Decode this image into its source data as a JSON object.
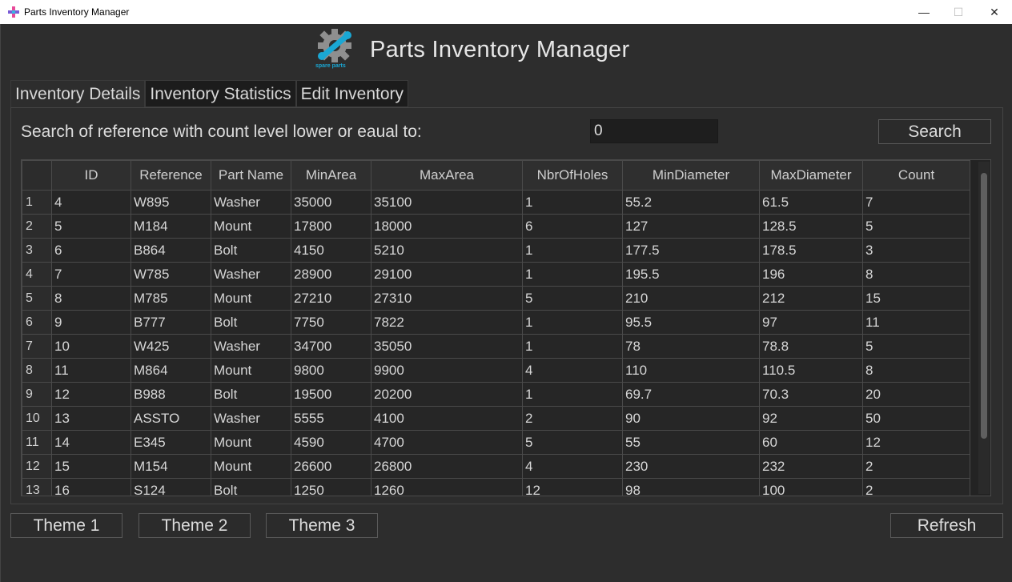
{
  "window": {
    "title": "Parts Inventory Manager",
    "minimize": "—",
    "maximize": "☐",
    "close": "✕"
  },
  "header": {
    "title": "Parts Inventory Manager",
    "logo_text": "spare parts",
    "logo_color": "#1aa7d4"
  },
  "tabs": [
    {
      "label": "Inventory Details",
      "active": true
    },
    {
      "label": "Inventory Statistics",
      "active": false
    },
    {
      "label": "Edit Inventory",
      "active": false
    }
  ],
  "search": {
    "label": "Search of reference with count level lower or eaual to:",
    "value": "0",
    "button": "Search"
  },
  "table": {
    "columns": [
      "ID",
      "Reference",
      "Part Name",
      "MinArea",
      "MaxArea",
      "NbrOfHoles",
      "MinDiameter",
      "MaxDiameter",
      "Count"
    ],
    "rows": [
      [
        "1",
        "4",
        "W895",
        "Washer",
        "35000",
        "35100",
        "1",
        "55.2",
        "61.5",
        "7"
      ],
      [
        "2",
        "5",
        "M184",
        "Mount",
        "17800",
        "18000",
        "6",
        "127",
        "128.5",
        "5"
      ],
      [
        "3",
        "6",
        "B864",
        "Bolt",
        "4150",
        "5210",
        "1",
        "177.5",
        "178.5",
        "3"
      ],
      [
        "4",
        "7",
        "W785",
        "Washer",
        "28900",
        "29100",
        "1",
        "195.5",
        "196",
        "8"
      ],
      [
        "5",
        "8",
        "M785",
        "Mount",
        "27210",
        "27310",
        "5",
        "210",
        "212",
        "15"
      ],
      [
        "6",
        "9",
        "B777",
        "Bolt",
        "7750",
        "7822",
        "1",
        "95.5",
        "97",
        "11"
      ],
      [
        "7",
        "10",
        "W425",
        "Washer",
        "34700",
        "35050",
        "1",
        "78",
        "78.8",
        "5"
      ],
      [
        "8",
        "11",
        "M864",
        "Mount",
        "9800",
        "9900",
        "4",
        "110",
        "110.5",
        "8"
      ],
      [
        "9",
        "12",
        "B988",
        "Bolt",
        "19500",
        "20200",
        "1",
        "69.7",
        "70.3",
        "20"
      ],
      [
        "10",
        "13",
        "ASSTO",
        "Washer",
        "5555",
        "4100",
        "2",
        "90",
        "92",
        "50"
      ],
      [
        "11",
        "14",
        "E345",
        "Mount",
        "4590",
        "4700",
        "5",
        "55",
        "60",
        "12"
      ],
      [
        "12",
        "15",
        "M154",
        "Mount",
        "26600",
        "26800",
        "4",
        "230",
        "232",
        "2"
      ],
      [
        "13",
        "16",
        "S124",
        "Bolt",
        "1250",
        "1260",
        "12",
        "98",
        "100",
        "2"
      ]
    ]
  },
  "footer": {
    "theme1": "Theme 1",
    "theme2": "Theme 2",
    "theme3": "Theme 3",
    "refresh": "Refresh"
  }
}
